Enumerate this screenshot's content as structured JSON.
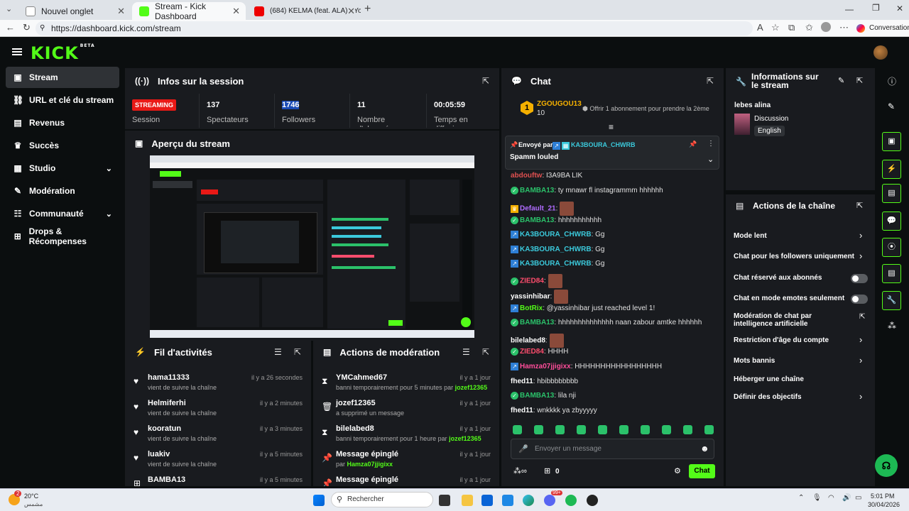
{
  "browser": {
    "tabs": [
      {
        "label": "Nouvel onglet"
      },
      {
        "label": "Stream - Kick Dashboard"
      },
      {
        "label": "(684) KELMA (feat. ALA) - YouTube"
      }
    ],
    "url": "https://dashboard.kick.com/stream",
    "conversation_label": "Conversation"
  },
  "brand": {
    "logo": "KICK",
    "beta": "BETA",
    "accent": "#53fc18"
  },
  "sidebar": {
    "items": [
      {
        "label": "Stream",
        "icon": "video-icon"
      },
      {
        "label": "URL et clé du stream",
        "icon": "link-icon"
      },
      {
        "label": "Revenus",
        "icon": "revenue-icon"
      },
      {
        "label": "Succès",
        "icon": "trophy-icon"
      },
      {
        "label": "Studio",
        "icon": "studio-icon"
      },
      {
        "label": "Modération",
        "icon": "wrench-icon"
      },
      {
        "label": "Communauté",
        "icon": "community-icon"
      },
      {
        "label": "Drops & Récompenses",
        "icon": "gift-icon"
      }
    ]
  },
  "session": {
    "title": "Infos sur la session",
    "status": "STREAMING",
    "status_label": "Session",
    "viewers": "137",
    "viewers_label": "Spectateurs",
    "followers": "1746",
    "followers_label": "Followers",
    "subs": "11",
    "subs_label": "Nombre d'abonnés",
    "duration": "00:05:59",
    "duration_label": "Temps en diffusion"
  },
  "preview": {
    "title": "Aperçu du stream"
  },
  "activity": {
    "title": "Fil d'activités",
    "rows": [
      {
        "name": "hama11333",
        "time": "il y a 26 secondes",
        "sub": "vient de suivre la chaîne"
      },
      {
        "name": "Helmiferhi",
        "time": "il y a 2 minutes",
        "sub": "vient de suivre la chaîne"
      },
      {
        "name": "kooratun",
        "time": "il y a 3 minutes",
        "sub": "vient de suivre la chaîne"
      },
      {
        "name": "luakiv",
        "time": "il y a 5 minutes",
        "sub": "vient de suivre la chaîne"
      },
      {
        "name": "BAMBA13",
        "time": "il y a 5 minutes",
        "sub": ""
      }
    ]
  },
  "moderation": {
    "title": "Actions de modération",
    "rows": [
      {
        "name": "YMCahmed67",
        "time": "il y a 1 jour",
        "sub": "banni temporairement pour 5 minutes par",
        "by": "jozef12365"
      },
      {
        "name": "jozef12365",
        "time": "il y a 1 jour",
        "sub": "a supprimé un message",
        "by": ""
      },
      {
        "name": "bilelabed8",
        "time": "il y a 1 jour",
        "sub": "banni temporairement pour 1 heure par",
        "by": "jozef12365"
      },
      {
        "name": "Message épinglé",
        "time": "il y a 1 jour",
        "sub": "par",
        "by": "Hamza07jjigixx"
      },
      {
        "name": "Message épinglé",
        "time": "il y a 1 jour",
        "sub": "",
        "by": ""
      }
    ]
  },
  "chat": {
    "title": "Chat",
    "top_user": "ZGOUGOU13",
    "top_rank": "1",
    "top_count": "10",
    "top_offer": "Offrir 1 abonnement pour prendre la 2ème",
    "pinned_label": "Envoyé par",
    "pinned_user": "KA3BOURA_CHWRB",
    "pinned_text": "Spamm louled",
    "messages": [
      {
        "user": "abdouftw",
        "text": ": I3A9BA LIK",
        "color": "#e05050",
        "badge": ""
      },
      {
        "user": "BAMBA13",
        "text": ": ty mnawr fl instagrammm hhhhhh",
        "color": "#2bc16a",
        "badge": "green"
      },
      {
        "user": "Default_21",
        "text": ":",
        "color": "#b06cff",
        "badge": "crown"
      },
      {
        "user": "BAMBA13",
        "text": ": hhhhhhhhhhh",
        "color": "#2bc16a",
        "badge": "green"
      },
      {
        "user": "KA3BOURA_CHWRB",
        "text": ": Gg",
        "color": "#3bc9db",
        "badge": "blue"
      },
      {
        "user": "KA3BOURA_CHWRB",
        "text": ": Gg",
        "color": "#3bc9db",
        "badge": "blue"
      },
      {
        "user": "KA3BOURA_CHWRB",
        "text": ": Gg",
        "color": "#3bc9db",
        "badge": "blue"
      },
      {
        "user": "ZIED84",
        "text": ":",
        "color": "#ff4d6d",
        "badge": "green"
      },
      {
        "user": "yassinhibar",
        "text": ":",
        "color": "#ffffff",
        "badge": ""
      },
      {
        "user": "BotRix",
        "text": ": @yassinhibar just reached level 1!",
        "color": "#53fc18",
        "badge": "blue"
      },
      {
        "user": "BAMBA13",
        "text": ": hhhhhhhhhhhhhh naan zabour amtke hhhhhh",
        "color": "#2bc16a",
        "badge": "green"
      },
      {
        "user": "bilelabed8",
        "text": ":",
        "color": "#ffffff",
        "badge": ""
      },
      {
        "user": "ZIED84",
        "text": ": HHHH",
        "color": "#ff4d6d",
        "badge": "green"
      },
      {
        "user": "Hamza07jjigixx",
        "text": ": HHHHHHHHHHHHHHHHH",
        "color": "#ff4d9a",
        "badge": "blue"
      },
      {
        "user": "fhed11",
        "text": ": hbibbbbbbbb",
        "color": "#ffffff",
        "badge": ""
      },
      {
        "user": "BAMBA13",
        "text": ": lila nji",
        "color": "#2bc16a",
        "badge": "green"
      },
      {
        "user": "fhed11",
        "text": ": wnkkkk ya zbyyyyy",
        "color": "#ffffff",
        "badge": ""
      }
    ],
    "input_placeholder": "Envoyer un message",
    "points": "0",
    "send_label": "Chat"
  },
  "channel_info": {
    "title": "Informations sur le stream",
    "stream_title": "lebes alina",
    "category": "Discussion",
    "language": "English"
  },
  "channel_actions": {
    "title": "Actions de la chaîne",
    "items": [
      {
        "label": "Mode lent",
        "control": "chevron"
      },
      {
        "label": "Chat pour les followers uniquement",
        "control": "chevron"
      },
      {
        "label": "Chat réservé aux abonnés",
        "control": "toggle"
      },
      {
        "label": "Chat en mode emotes seulement",
        "control": "toggle"
      },
      {
        "label": "Modération de chat par intelligence artificielle",
        "control": "external"
      },
      {
        "label": "Restriction d'âge du compte",
        "control": "chevron"
      },
      {
        "label": "Mots bannis",
        "control": "chevron"
      },
      {
        "label": "Héberger une chaîne",
        "control": "none"
      },
      {
        "label": "Définir des objectifs",
        "control": "chevron"
      }
    ]
  },
  "taskbar": {
    "weather_temp": "20°C",
    "weather_label": "مشمس",
    "search_placeholder": "Rechercher",
    "time": "5:01 PM",
    "date": "30/04/2026",
    "notif_badge": "2",
    "discord_badge": "99+"
  }
}
